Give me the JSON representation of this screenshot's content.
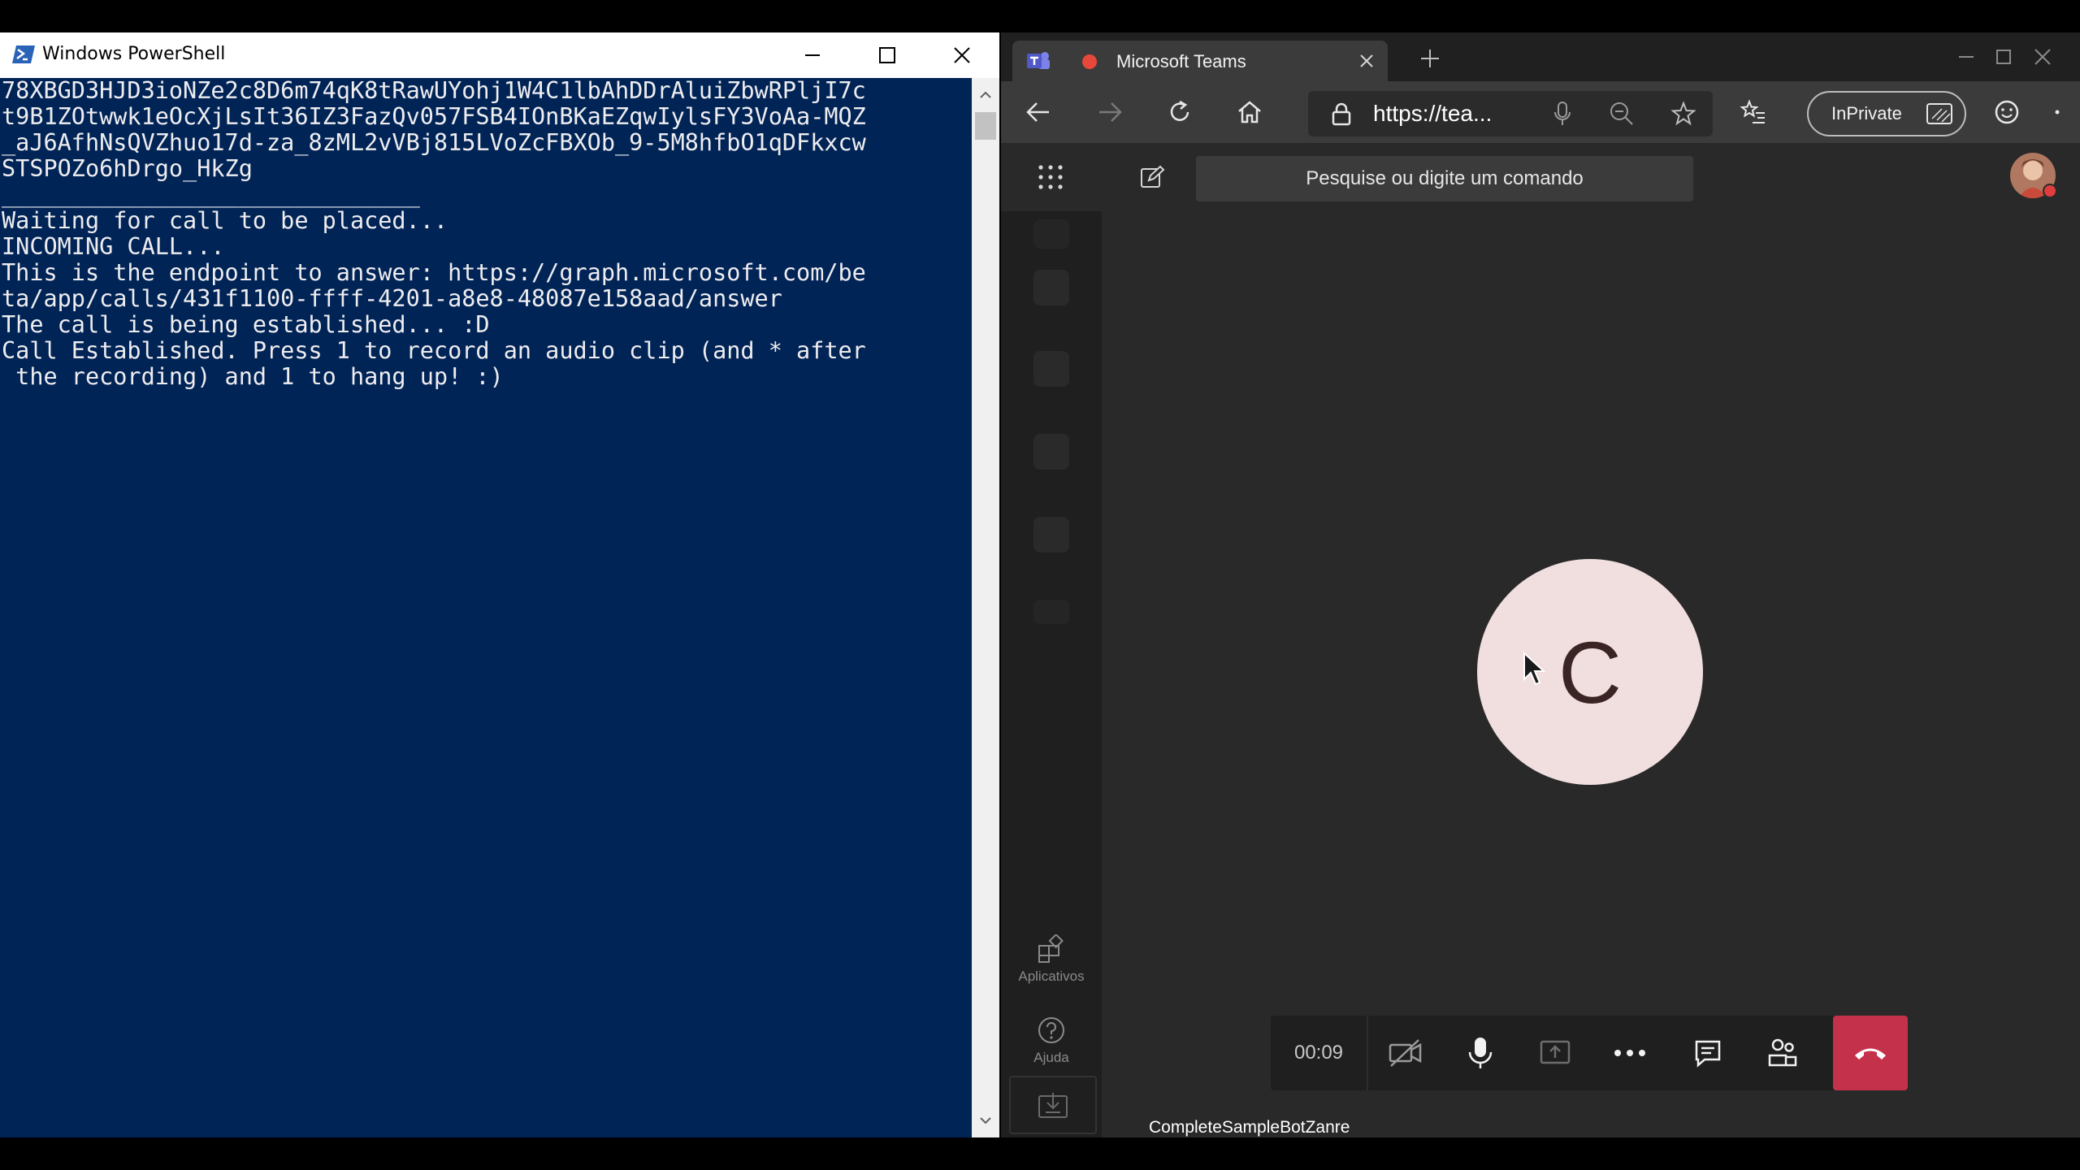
{
  "powershell": {
    "title": "Windows PowerShell",
    "output": [
      "78XBGD3HJD3ioNZe2c8D6m74qK8tRawUYohj1W4C1lbAhDDrAluiZbwRPljI7c",
      "t9B1ZOtwwk1eOcXjLsIt36IZ3FazQv057FSB4IOnBKaEZqwIylsFY3VoAa-MQZ",
      "_aJ6AfhNsQVZhuo17d-za_8zML2vVBj815LVoZcFBXOb_9-5M8hfbO1qDFkxcw",
      "STSPOZo6hDrgo_HkZg",
      "",
      "______________________________",
      "",
      "Waiting for call to be placed...",
      "INCOMING CALL...",
      "This is the endpoint to answer: https://graph.microsoft.com/be",
      "ta/app/calls/431f1100-ffff-4201-a8e8-48087e158aad/answer",
      "The call is being established... :D",
      "Call Established. Press 1 to record an audio clip (and * after",
      " the recording) and 1 to hang up! :)"
    ]
  },
  "browser": {
    "tab_title": "Microsoft Teams",
    "address_url": "https://tea...",
    "inprivate_label": "InPrivate"
  },
  "teams": {
    "search_placeholder": "Pesquise ou digite um comando",
    "rail": {
      "apps_label": "Aplicativos",
      "help_label": "Ajuda"
    },
    "call": {
      "avatar_initial": "C",
      "timer": "00:09",
      "participant_name": "CompleteSampleBotZanre"
    }
  },
  "colors": {
    "powershell_bg": "#012456",
    "powershell_text": "#eeedf0",
    "hangup_red": "#c4314b",
    "avatar_bg": "#f1dede",
    "teams_purple": "#5b5fc7"
  }
}
